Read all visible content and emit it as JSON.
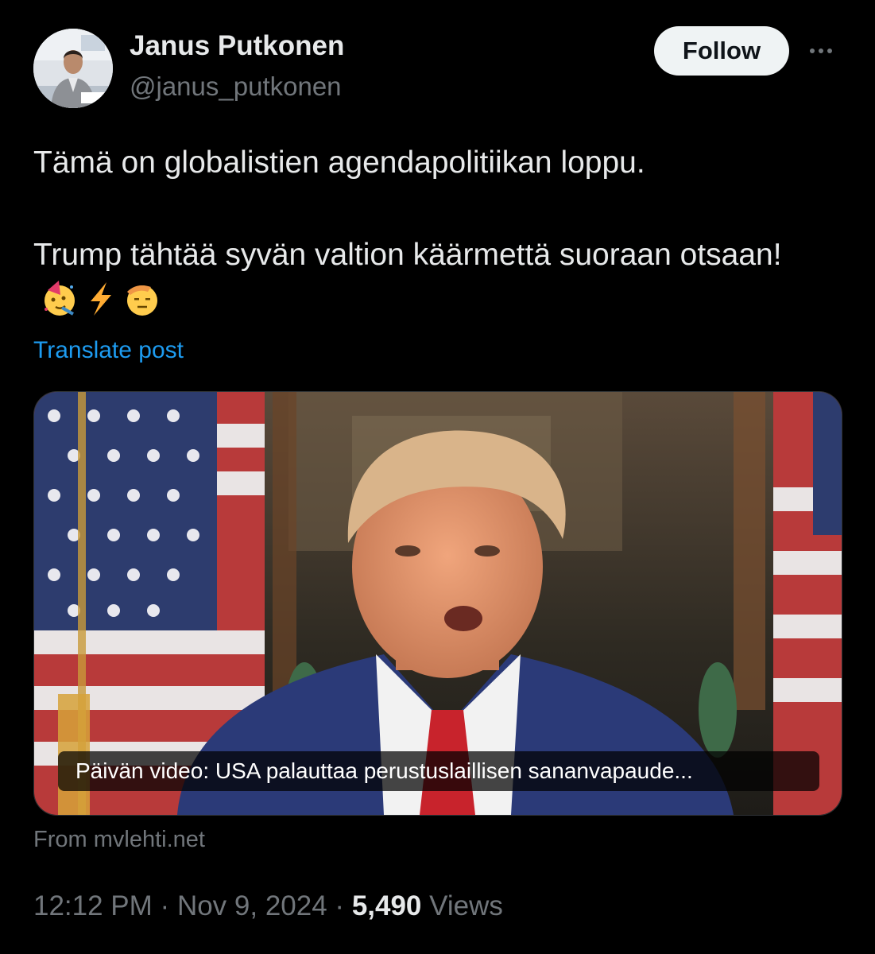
{
  "author": {
    "display_name": "Janus Putkonen",
    "handle": "@janus_putkonen",
    "avatar_icon": "profile-photo"
  },
  "actions": {
    "follow_label": "Follow",
    "more_icon": "more-horizontal-icon"
  },
  "post": {
    "line1": "Tämä on globalistien agendapolitiikan loppu.",
    "line2": "Trump tähtää syvän valtion käärmettä suoraan otsaan!",
    "emojis": [
      "partying-face-emoji",
      "high-voltage-emoji",
      "saluting-face-emoji"
    ],
    "translate_label": "Translate post"
  },
  "media": {
    "caption": "Päivän video: USA palauttaa perustuslaillisen sananvapaude...",
    "source": "From mvlehti.net"
  },
  "meta": {
    "time": "12:12 PM",
    "separator": "·",
    "date": "Nov 9, 2024",
    "views_count": "5,490",
    "views_label": "Views"
  },
  "colors": {
    "background": "#000000",
    "primary_text": "#e7e9ea",
    "secondary_text": "#71767b",
    "link": "#1d9bf0",
    "follow_bg": "#eff3f4"
  }
}
